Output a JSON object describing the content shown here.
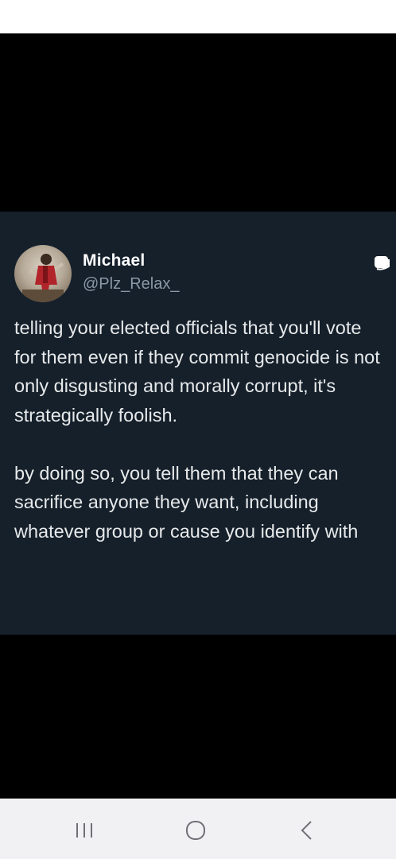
{
  "tweet": {
    "display_name": "Michael",
    "handle": "@Plz_Relax_",
    "paragraphs": [
      "telling your elected officials that you'll vote for them even if they commit genocide is not only disgusting and morally corrupt, it's strategically foolish.",
      "by doing so, you tell them that they can sacrifice anyone they want, including whatever group or cause you identify with"
    ]
  },
  "icons": {
    "avatar": "profile-photo",
    "more": "overflow-menu-icon",
    "nav_recents": "recent-apps-icon",
    "nav_home": "home-icon",
    "nav_back": "back-icon"
  },
  "colors": {
    "card_background": "#15202b",
    "text_primary": "#e7e9ea",
    "text_secondary": "#8b98a5",
    "nav_background": "#f1f1f3"
  }
}
